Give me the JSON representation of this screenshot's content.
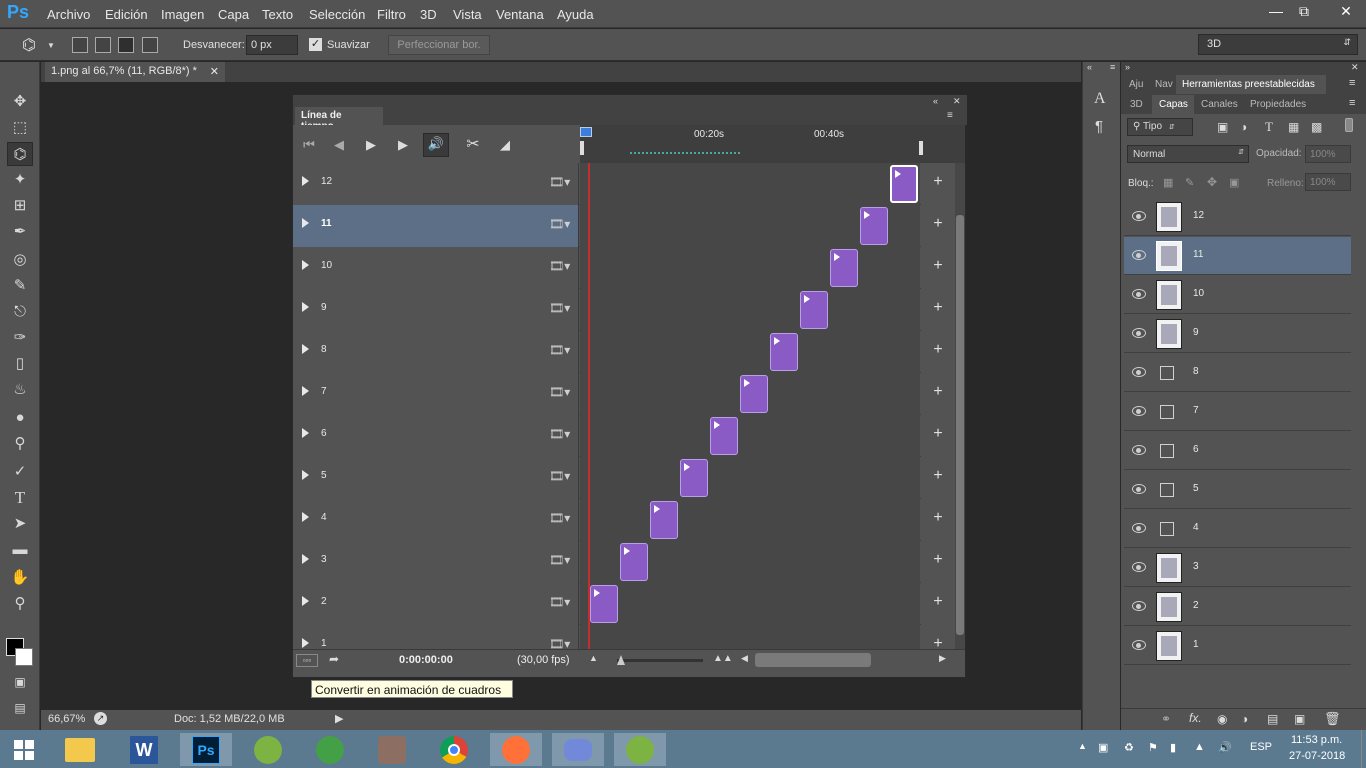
{
  "app": {
    "logo": "Ps"
  },
  "menubar": {
    "items": [
      "Archivo",
      "Edición",
      "Imagen",
      "Capa",
      "Texto",
      "Selección",
      "Filtro",
      "3D",
      "Vista",
      "Ventana",
      "Ayuda"
    ]
  },
  "options": {
    "feather_label": "Desvanecer:",
    "feather_value": "0 px",
    "smooth_label": "Suavizar",
    "refine_label": "Perfeccionar bor.",
    "workspace": "3D"
  },
  "document": {
    "tab_title": "1.png al 66,7% (11, RGB/8*) *"
  },
  "status": {
    "zoom": "66,67%",
    "doc_info": "Doc: 1,52 MB/22,0 MB"
  },
  "timeline": {
    "title": "Línea de tiempo",
    "ruler_marks": [
      "00:20s",
      "00:40s"
    ],
    "timecode": "0:00:00:00",
    "fps": "(30,00 fps)",
    "rows": [
      {
        "label": "12",
        "selected": false
      },
      {
        "label": "11",
        "selected": true
      },
      {
        "label": "10",
        "selected": false
      },
      {
        "label": "9",
        "selected": false
      },
      {
        "label": "8",
        "selected": false
      },
      {
        "label": "7",
        "selected": false
      },
      {
        "label": "6",
        "selected": false
      },
      {
        "label": "5",
        "selected": false
      },
      {
        "label": "4",
        "selected": false
      },
      {
        "label": "3",
        "selected": false
      },
      {
        "label": "2",
        "selected": false
      },
      {
        "label": "1",
        "selected": false
      }
    ]
  },
  "tooltip": "Convertir en animación de cuadros",
  "panels": {
    "top_tabs": [
      "Aju",
      "Nav",
      "Herramientas preestablecidas"
    ],
    "tabs": [
      "3D",
      "Capas",
      "Canales",
      "Propiedades"
    ],
    "filter_kind": "Tipo",
    "blend_mode": "Normal",
    "opacity_label": "Opacidad:",
    "opacity_value": "100%",
    "lock_label": "Bloq.:",
    "fill_label": "Relleno:",
    "fill_value": "100%",
    "layers": [
      {
        "name": "12",
        "type": "image",
        "selected": false
      },
      {
        "name": "11",
        "type": "image",
        "selected": true
      },
      {
        "name": "10",
        "type": "image",
        "selected": false
      },
      {
        "name": "9",
        "type": "image",
        "selected": false
      },
      {
        "name": "8",
        "type": "smart",
        "selected": false
      },
      {
        "name": "7",
        "type": "smart",
        "selected": false
      },
      {
        "name": "6",
        "type": "smart",
        "selected": false
      },
      {
        "name": "5",
        "type": "smart",
        "selected": false
      },
      {
        "name": "4",
        "type": "smart",
        "selected": false
      },
      {
        "name": "3",
        "type": "image",
        "selected": false
      },
      {
        "name": "2",
        "type": "image",
        "selected": false
      },
      {
        "name": "1",
        "type": "image",
        "selected": false
      }
    ]
  },
  "taskbar": {
    "lang": "ESP",
    "time": "11:53 p.m.",
    "date": "27-07-2018",
    "apps": [
      "explorer-icon",
      "word-icon",
      "photoshop-icon",
      "corel-icon",
      "corel2-icon",
      "winrar-icon",
      "chrome-icon",
      "firefox-icon",
      "discord-icon",
      "corel3-icon"
    ]
  }
}
